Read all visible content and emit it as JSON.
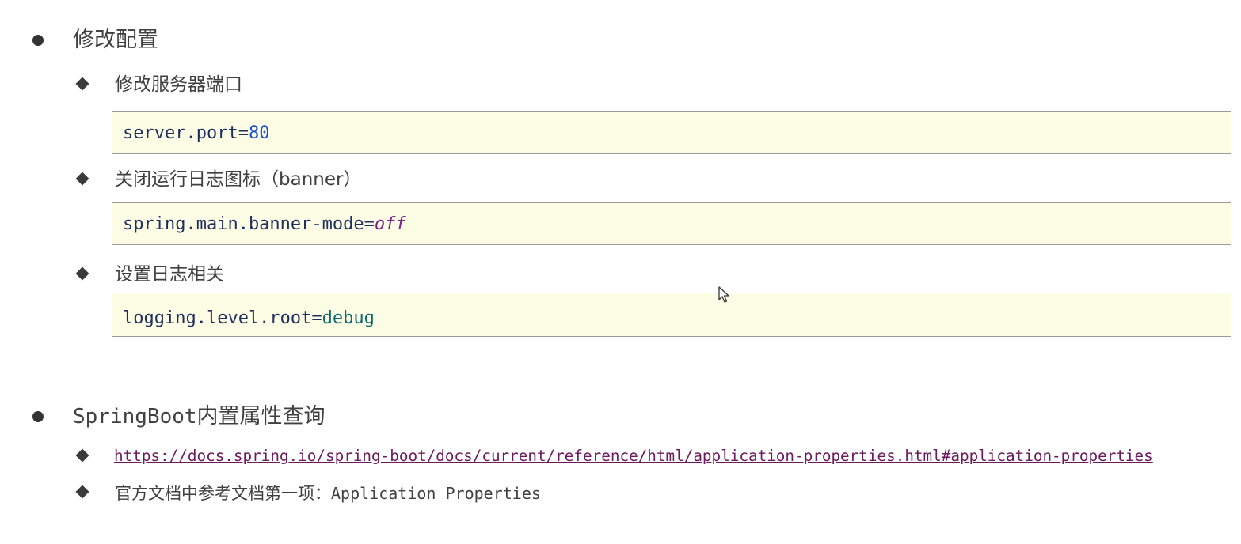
{
  "section1": {
    "title": "修改配置",
    "items": [
      {
        "label": "修改服务器端口",
        "code_key": "server.port=",
        "code_value": "80"
      },
      {
        "label": "关闭运行日志图标（banner）",
        "code_key": "spring.main.banner-mode=",
        "code_value": "off"
      },
      {
        "label": "设置日志相关",
        "code_key": "logging.level.root=",
        "code_value": "debug"
      }
    ]
  },
  "section2": {
    "title_prefix": "SpringBoot",
    "title_suffix": "内置属性查询",
    "link": "https://docs.spring.io/spring-boot/docs/current/reference/html/application-properties.html#application-properties",
    "note_prefix": "官方文档中参考文档第一项：",
    "note_suffix": "Application Properties"
  },
  "colors": {
    "code_background": "#fdfde6",
    "code_border": "#9a9a9a",
    "code_key": "#1d2f5e",
    "number_value": "#1a4fd0",
    "keyword_value": "#7a1f8a",
    "identifier_value": "#0b6b6b",
    "link": "#6b1a5e"
  },
  "icons": {
    "top_bullet": "filled-circle",
    "sub_bullet": "diamond",
    "pointer": "mouse-cursor-arrow"
  }
}
